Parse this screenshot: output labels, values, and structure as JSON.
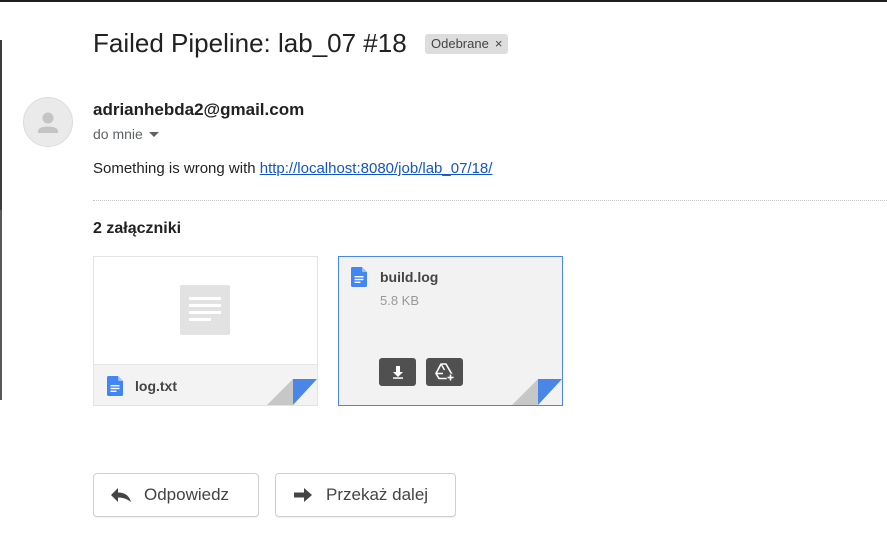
{
  "email": {
    "subject": "Failed Pipeline: lab_07 #18",
    "label": "Odebrane",
    "label_remove": "×",
    "sender": "adrianhebda2@gmail.com",
    "recipient": "do mnie",
    "body_prefix": "Something is wrong with ",
    "body_link": "http://localhost:8080/job/lab_07/18/"
  },
  "attachments": {
    "count_label": "2 załączniki",
    "items": [
      {
        "name": "log.txt"
      },
      {
        "name": "build.log",
        "size": "5.8 KB"
      }
    ]
  },
  "actions": {
    "reply_label": "Odpowiedz",
    "forward_label": "Przekaż dalej"
  },
  "colors": {
    "link": "#1155cc",
    "doc_icon": "#4285f4",
    "selected_border": "#4a86e8"
  }
}
